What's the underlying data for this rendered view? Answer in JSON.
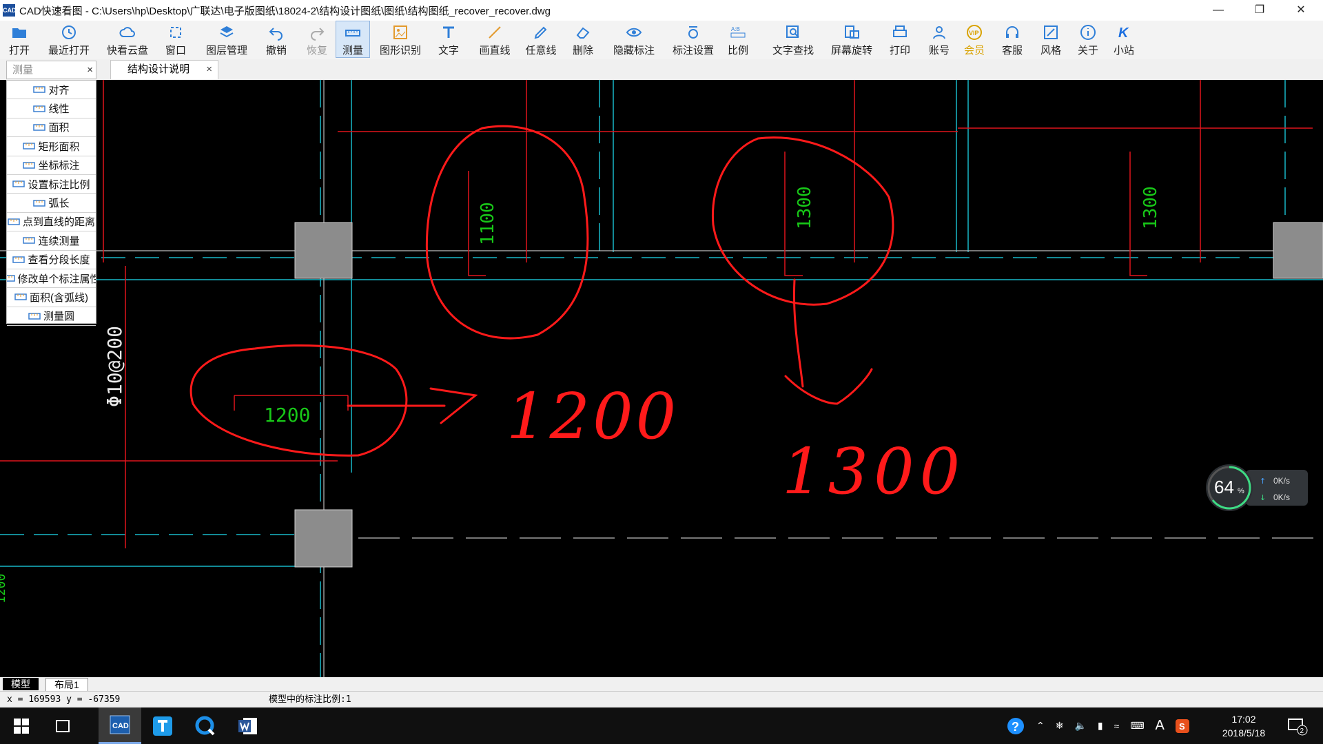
{
  "app": {
    "title": "CAD快速看图 - C:\\Users\\hp\\Desktop\\广联达\\电子版图纸\\18024-2\\结构设计图纸\\图纸\\结构图纸_recover_recover.dwg",
    "icon_text": "CAD"
  },
  "toolbar": {
    "items": [
      {
        "label": "打开",
        "icon": "folder-open-icon"
      },
      {
        "label": "最近打开",
        "icon": "clock-icon"
      },
      {
        "label": "快看云盘",
        "icon": "cloud-icon"
      },
      {
        "label": "窗口",
        "icon": "window-icon"
      },
      {
        "label": "图层管理",
        "icon": "layers-icon"
      },
      {
        "label": "撤销",
        "icon": "undo-icon"
      },
      {
        "label": "恢复",
        "icon": "redo-icon"
      },
      {
        "label": "测量",
        "icon": "ruler-icon"
      },
      {
        "label": "图形识别",
        "icon": "image-recognize-icon"
      },
      {
        "label": "文字",
        "icon": "text-icon"
      },
      {
        "label": "画直线",
        "icon": "line-icon"
      },
      {
        "label": "任意线",
        "icon": "pencil-icon"
      },
      {
        "label": "删除",
        "icon": "eraser-icon"
      },
      {
        "label": "隐藏标注",
        "icon": "eye-icon"
      },
      {
        "label": "标注设置",
        "icon": "annotation-settings-icon"
      },
      {
        "label": "比例",
        "icon": "scale-icon"
      },
      {
        "label": "文字查找",
        "icon": "text-search-icon"
      },
      {
        "label": "屏幕旋转",
        "icon": "rotate-screen-icon"
      },
      {
        "label": "打印",
        "icon": "printer-icon"
      },
      {
        "label": "账号",
        "icon": "user-icon"
      },
      {
        "label": "会员",
        "icon": "vip-icon",
        "badge": "VIP"
      },
      {
        "label": "客服",
        "icon": "headset-icon"
      },
      {
        "label": "风格",
        "icon": "style-icon"
      },
      {
        "label": "关于",
        "icon": "info-icon"
      },
      {
        "label": "小站",
        "icon": "k-icon",
        "badge": "K"
      }
    ],
    "active": "测量",
    "disabled": [
      "恢复"
    ]
  },
  "tabs": {
    "measure_panel_title": "测量",
    "document_tab": "结构设计说明",
    "close_glyph": "×"
  },
  "measure_menu": {
    "items": [
      "对齐",
      "线性",
      "面积",
      "矩形面积",
      "坐标标注",
      "设置标注比例",
      "弧长",
      "点到直线的距离",
      "连续测量",
      "查看分段长度",
      "修改单个标注属性",
      "面积(含弧线)",
      "测量圆"
    ]
  },
  "drawing": {
    "dims_green": [
      "1100",
      "1300",
      "1300",
      "1200"
    ],
    "rebar_label": "Φ10@200",
    "partial_label": "1200",
    "handwritten": [
      "1200",
      "1300"
    ]
  },
  "net_monitor": {
    "percent": "64",
    "percent_unit": "%",
    "upload": "0K/s",
    "download": "0K/s"
  },
  "layout_tabs": [
    "模型",
    "布局1"
  ],
  "status": {
    "coords": "x = 169593  y = -67359",
    "scale_text": "模型中的标注比例:1"
  },
  "taskbar": {
    "time": "17:02",
    "date": "2018/5/18",
    "notification_count": "2",
    "ime": "A"
  },
  "colors": {
    "cad_red": "#e0141c",
    "cad_cyan": "#18b8c8",
    "cad_green": "#18c818",
    "column_gray": "#8c8c8c"
  }
}
